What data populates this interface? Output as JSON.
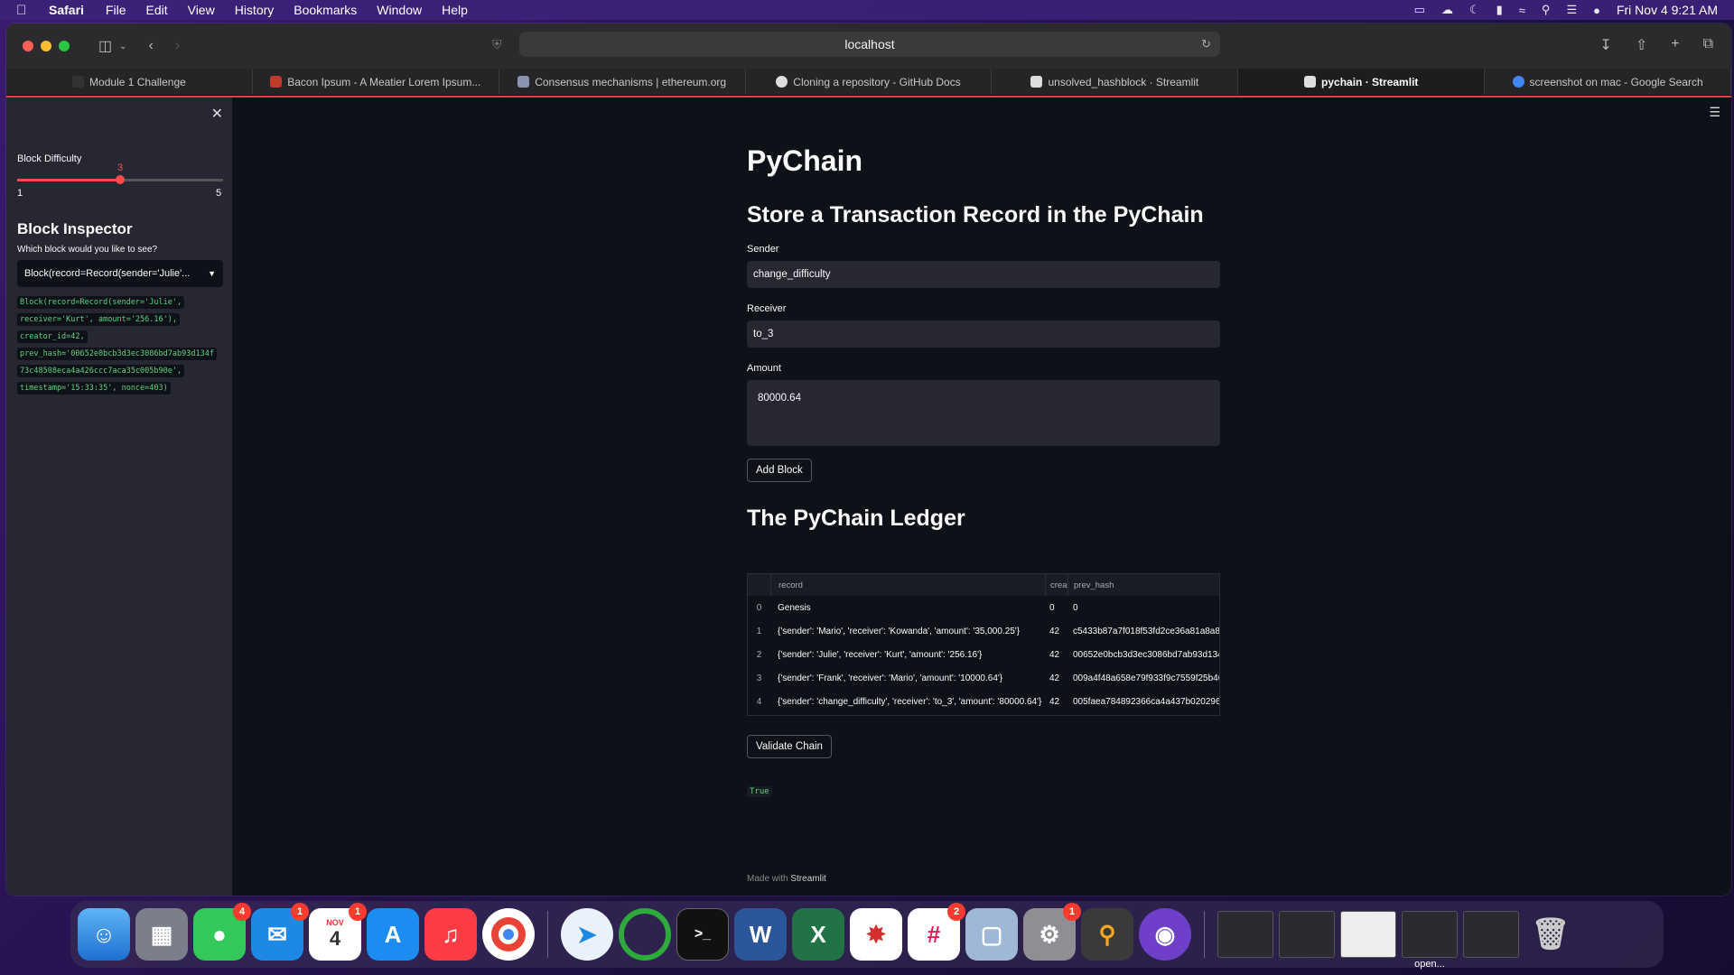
{
  "menubar": {
    "app_name": "Safari",
    "items": [
      "File",
      "Edit",
      "View",
      "History",
      "Bookmarks",
      "Window",
      "Help"
    ],
    "clock": "Fri Nov 4  9:21 AM"
  },
  "browser": {
    "url": "localhost",
    "tabs": [
      {
        "label": "Module 1 Challenge",
        "active": false
      },
      {
        "label": "Bacon Ipsum - A Meatier Lorem Ipsum...",
        "active": false
      },
      {
        "label": "Consensus mechanisms | ethereum.org",
        "active": false
      },
      {
        "label": "Cloning a repository - GitHub Docs",
        "active": false
      },
      {
        "label": "unsolved_hashblock · Streamlit",
        "active": false
      },
      {
        "label": "pychain · Streamlit",
        "active": true
      },
      {
        "label": "screenshot on mac - Google Search",
        "active": false
      }
    ]
  },
  "sidebar": {
    "difficulty_label": "Block Difficulty",
    "difficulty_value": "3",
    "difficulty_min": "1",
    "difficulty_max": "5",
    "difficulty_fraction": 0.5,
    "inspector_title": "Block Inspector",
    "select_label": "Which block would you like to see?",
    "select_value": "Block(record=Record(sender='Julie'...",
    "code_lines": [
      "Block(record=Record(sender='Julie',",
      "receiver='Kurt', amount='256.16'),",
      "creator_id=42,",
      "prev_hash='00652e0bcb3d3ec3086bd7ab93d134f",
      "73c48508eca4a426ccc7aca35c005b90e',",
      "timestamp='15:33:35', nonce=403)"
    ]
  },
  "main": {
    "title": "PyChain",
    "subtitle": "Store a Transaction Record in the PyChain",
    "sender_label": "Sender",
    "sender_value": "change_difficulty",
    "receiver_label": "Receiver",
    "receiver_value": "to_3",
    "amount_label": "Amount",
    "amount_value": "80000.64",
    "add_button": "Add Block",
    "ledger_title": "The PyChain Ledger",
    "table": {
      "headers": [
        "",
        "record",
        "creat",
        "prev_hash"
      ],
      "rows": [
        [
          "0",
          "Genesis",
          "0",
          "0"
        ],
        [
          "1",
          "{'sender': 'Mario', 'receiver': 'Kowanda', 'amount': '35,000.25'}",
          "42",
          "c5433b87a7f018f53fd2ce36a81a8a8"
        ],
        [
          "2",
          "{'sender': 'Julie', 'receiver': 'Kurt', 'amount': '256.16'}",
          "42",
          "00652e0bcb3d3ec3086bd7ab93d134"
        ],
        [
          "3",
          "{'sender': 'Frank', 'receiver': 'Mario', 'amount': '10000.64'}",
          "42",
          "009a4f48a658e79f933f9c7559f25b46"
        ],
        [
          "4",
          "{'sender': 'change_difficulty', 'receiver': 'to_3', 'amount': '80000.64'}",
          "42",
          "005faea784892366ca4a437b0202969"
        ]
      ]
    },
    "validate_button": "Validate Chain",
    "validate_result": "True",
    "footer_prefix": "Made with",
    "footer_brand": "Streamlit"
  },
  "dock": {
    "badges": {
      "messages": "4",
      "mail": "1",
      "calendar": "1",
      "slack": "2",
      "settings": "1"
    },
    "calendar_month": "NOV",
    "calendar_day": "4",
    "last_thumb_label": "open..."
  }
}
